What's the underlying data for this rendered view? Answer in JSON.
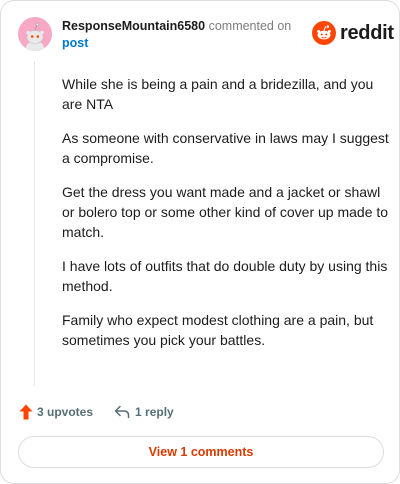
{
  "comment": {
    "username": "ResponseMountain6580",
    "commented_text": "commented on",
    "post_link": "post",
    "paragraphs": [
      "While she is being a pain and a bridezilla, and you are NTA",
      "As someone with conservative in laws may I suggest a compromise.",
      "Get the dress you want made and a jacket or shawl or bolero top or some other kind of cover up made to match.",
      "I have lots of outfits that do double duty by using this method.",
      "Family who expect modest clothing are a pain, but sometimes you pick your battles."
    ]
  },
  "logo": {
    "text": "reddit",
    "icon": "reddit-snoo-icon",
    "color": "#ff4500"
  },
  "actions": {
    "upvotes_label": "3 upvotes",
    "upvote_icon": "upvote-arrow-icon",
    "upvote_color": "#ff4500",
    "reply_label": "1 reply",
    "reply_icon": "reply-arrow-icon"
  },
  "view_comments_label": "View 1 comments",
  "accent_color": "#d93a00",
  "link_color": "#0079d3"
}
